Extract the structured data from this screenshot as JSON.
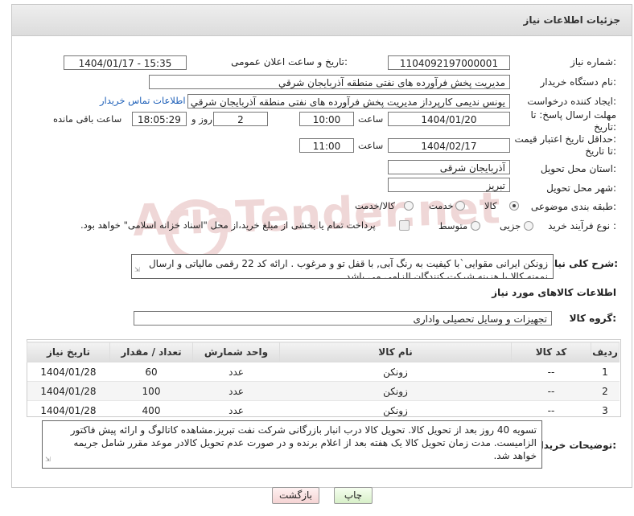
{
  "header": {
    "title": "جزئیات اطلاعات نیاز"
  },
  "form": {
    "need_number": {
      "label": "شماره نیاز:",
      "value": "1104092197000001"
    },
    "announce": {
      "label": "تاریخ و ساعت اعلان عمومی:",
      "value": "1404/01/17 - 15:35"
    },
    "buyer_org": {
      "label": "نام دستگاه خریدار:",
      "value": "مدیریت پخش فرآورده های نفتی منطقه آذربایجان شرقي"
    },
    "requester": {
      "label": "ایجاد کننده درخواست:",
      "value": "یونس ندیمی کارپرداز مدیریت پخش فرآورده های نفتی منطقه آذربایجان شرقي",
      "contact_link": "اطلاعات تماس خریدار"
    },
    "reply_deadline": {
      "label_line1": "مهلت ارسال پاسخ: تا",
      "label_line2": "تاریخ:",
      "date": "1404/01/20",
      "time_label": "ساعت",
      "time": "10:00",
      "days": "2",
      "days_label": "روز و",
      "remaining": "18:05:29",
      "remaining_label": "ساعت باقی مانده"
    },
    "price_validity": {
      "label_line1": "حداقل تاریخ اعتبار قیمت:",
      "label_line2": "تا تاریخ:",
      "date": "1404/02/17",
      "time_label": "ساعت",
      "time": "11:00"
    },
    "delivery_province": {
      "label": "استان محل تحویل:",
      "value": "آذربایجان شرقی"
    },
    "delivery_city": {
      "label": "شهر محل تحویل:",
      "value": "تبریز"
    },
    "category": {
      "label": "طبقه بندی موضوعی:",
      "options": [
        "کالا",
        "خدمت",
        "کالا/خدمت"
      ],
      "selected": "کالا"
    },
    "purchase_type": {
      "label": "نوع فرآیند خرید :",
      "options": [
        "جزیی",
        "متوسط"
      ],
      "selected": "",
      "payment_note": "پرداخت تمام یا بخشی از مبلغ خرید،از محل \"اسناد خزانه اسلامی\" خواهد بود."
    }
  },
  "description": {
    "label": "شرح کلی نیاز:",
    "text": "زونکن ایرانی مقوایی`با کیفیت به رنگ آبی, با قفل تو و مرغوب . ارائه کد 22 رقمی مالیاتی و ارسال نمونه کالا با هزینه شرکت کنندگان الزامی می باشد."
  },
  "items_section": {
    "title": "اطلاعات کالاهای مورد نیاز",
    "group_label": "گروه کالا:",
    "group_value": "تجهیزات و وسایل تحصیلی واداری",
    "columns": [
      "ردیف",
      "کد کالا",
      "نام کالا",
      "واحد شمارش",
      "تعداد / مقدار",
      "تاریخ نیاز"
    ],
    "rows": [
      [
        "1",
        "--",
        "زونکن",
        "عدد",
        "60",
        "1404/01/28"
      ],
      [
        "2",
        "--",
        "زونکن",
        "عدد",
        "100",
        "1404/01/28"
      ],
      [
        "3",
        "--",
        "زونکن",
        "عدد",
        "400",
        "1404/01/28"
      ]
    ]
  },
  "buyer_notes": {
    "label": "توضیحات خریدار:",
    "text": "تسویه 40 روز بعد از تحویل کالا. تحویل کالا درب انبار بازرگانی شرکت نفت تبریز.مشاهده کاتالوگ و ارائه پیش فاکتور الزامیست. مدت زمان تحویل کالا یک هفته بعد از اعلام برنده و در صورت عدم تحویل کالادر موعد مقرر شامل جریمه خواهد شد."
  },
  "buttons": {
    "print": "چاپ",
    "back": "بازگشت"
  },
  "watermark": "AriaTender.net"
}
